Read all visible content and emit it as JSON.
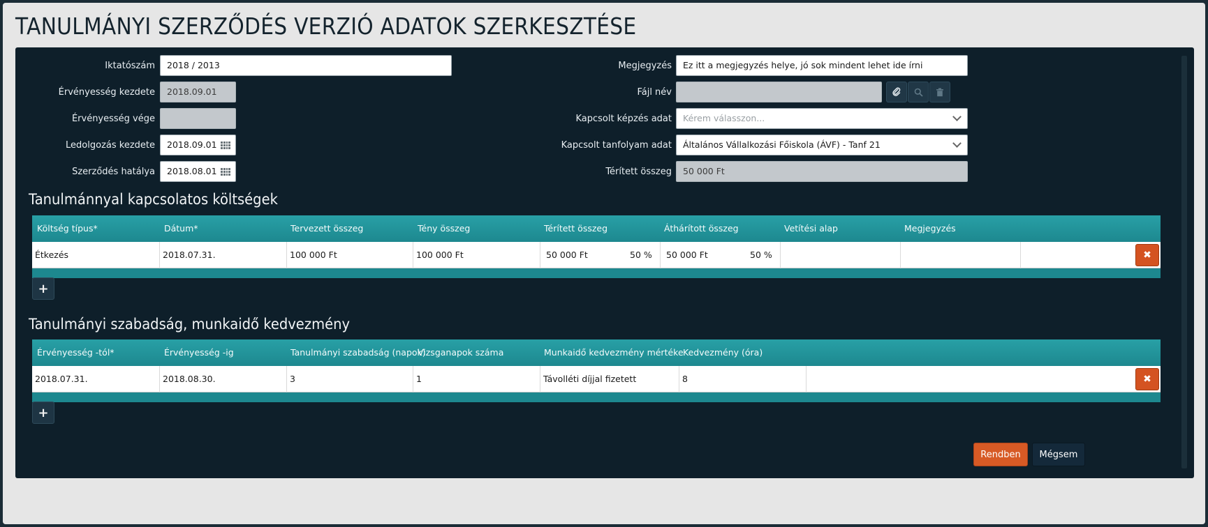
{
  "title": "TANULMÁNYI SZERZŐDÉS VERZIÓ ADATOK SZERKESZTÉSE",
  "form": {
    "iktatoszam": {
      "label": "Iktatószám",
      "value": "2018 / 2013"
    },
    "ervenyesseg_kezdete": {
      "label": "Érvényesség kezdete",
      "value": "2018.09.01"
    },
    "ervenyesseg_vege": {
      "label": "Érvényesség vége",
      "value": ""
    },
    "ledolgozas_kezdete": {
      "label": "Ledolgozás kezdete",
      "value": "2018.09.01"
    },
    "szerzodes_hatalya": {
      "label": "Szerződés hatálya",
      "value": "2018.08.01"
    },
    "megjegyzes": {
      "label": "Megjegyzés",
      "value": "Ez itt a megjegyzés helye, jó sok mindent lehet ide írni"
    },
    "fajl_nev": {
      "label": "Fájl név",
      "value": ""
    },
    "kapcsolt_kepzes": {
      "label": "Kapcsolt képzés adat",
      "placeholder": "Kérem válasszon..."
    },
    "kapcsolt_tanfolyam": {
      "label": "Kapcsolt tanfolyam adat",
      "value": "Általános Vállalkozási Főiskola (ÁVF) - Tanf 21"
    },
    "teritett_osszeg": {
      "label": "Térített összeg",
      "value": "50 000 Ft"
    }
  },
  "costs": {
    "title": "Tanulmánnyal kapcsolatos költségek",
    "headers": [
      "Költség típus*",
      "Dátum*",
      "Tervezett összeg",
      "Tény összeg",
      "Térített összeg",
      "Áthárított összeg",
      "Vetítési alap",
      "Megjegyzés"
    ],
    "rows": [
      {
        "tipus": "Étkezés",
        "datum": "2018.07.31.",
        "tervezett": "100 000 Ft",
        "teny": "100 000 Ft",
        "teritett": "50 000 Ft",
        "teritett_pct": "50 %",
        "atharitott": "50 000 Ft",
        "atharitott_pct": "50 %",
        "vetitesi": "",
        "megjegyzes": ""
      }
    ]
  },
  "leave": {
    "title": "Tanulmányi szabadság, munkaidő kedvezmény",
    "headers": [
      "Érvényesség -tól*",
      "Érvényesség -ig",
      "Tanulmányi szabadság (napok)",
      "Vizsganapok száma",
      "Munkaidő kedvezmény mértéke",
      "Kedvezmény (óra)"
    ],
    "rows": [
      {
        "tol": "2018.07.31.",
        "ig": "2018.08.30.",
        "napok": "3",
        "vizsganapok": "1",
        "mertek": "Távolléti díjjal fizetett",
        "ora": "8"
      }
    ]
  },
  "buttons": {
    "ok": "Rendben",
    "cancel": "Mégsem",
    "add": "+",
    "delete": "✖"
  },
  "icons": {
    "attach": "paperclip-icon",
    "search": "search-icon",
    "trash": "trash-icon",
    "calendar": "calendar-icon"
  },
  "colors": {
    "accent_teal": "#1d888f",
    "danger": "#d45321",
    "panel": "#0e1f2a"
  }
}
